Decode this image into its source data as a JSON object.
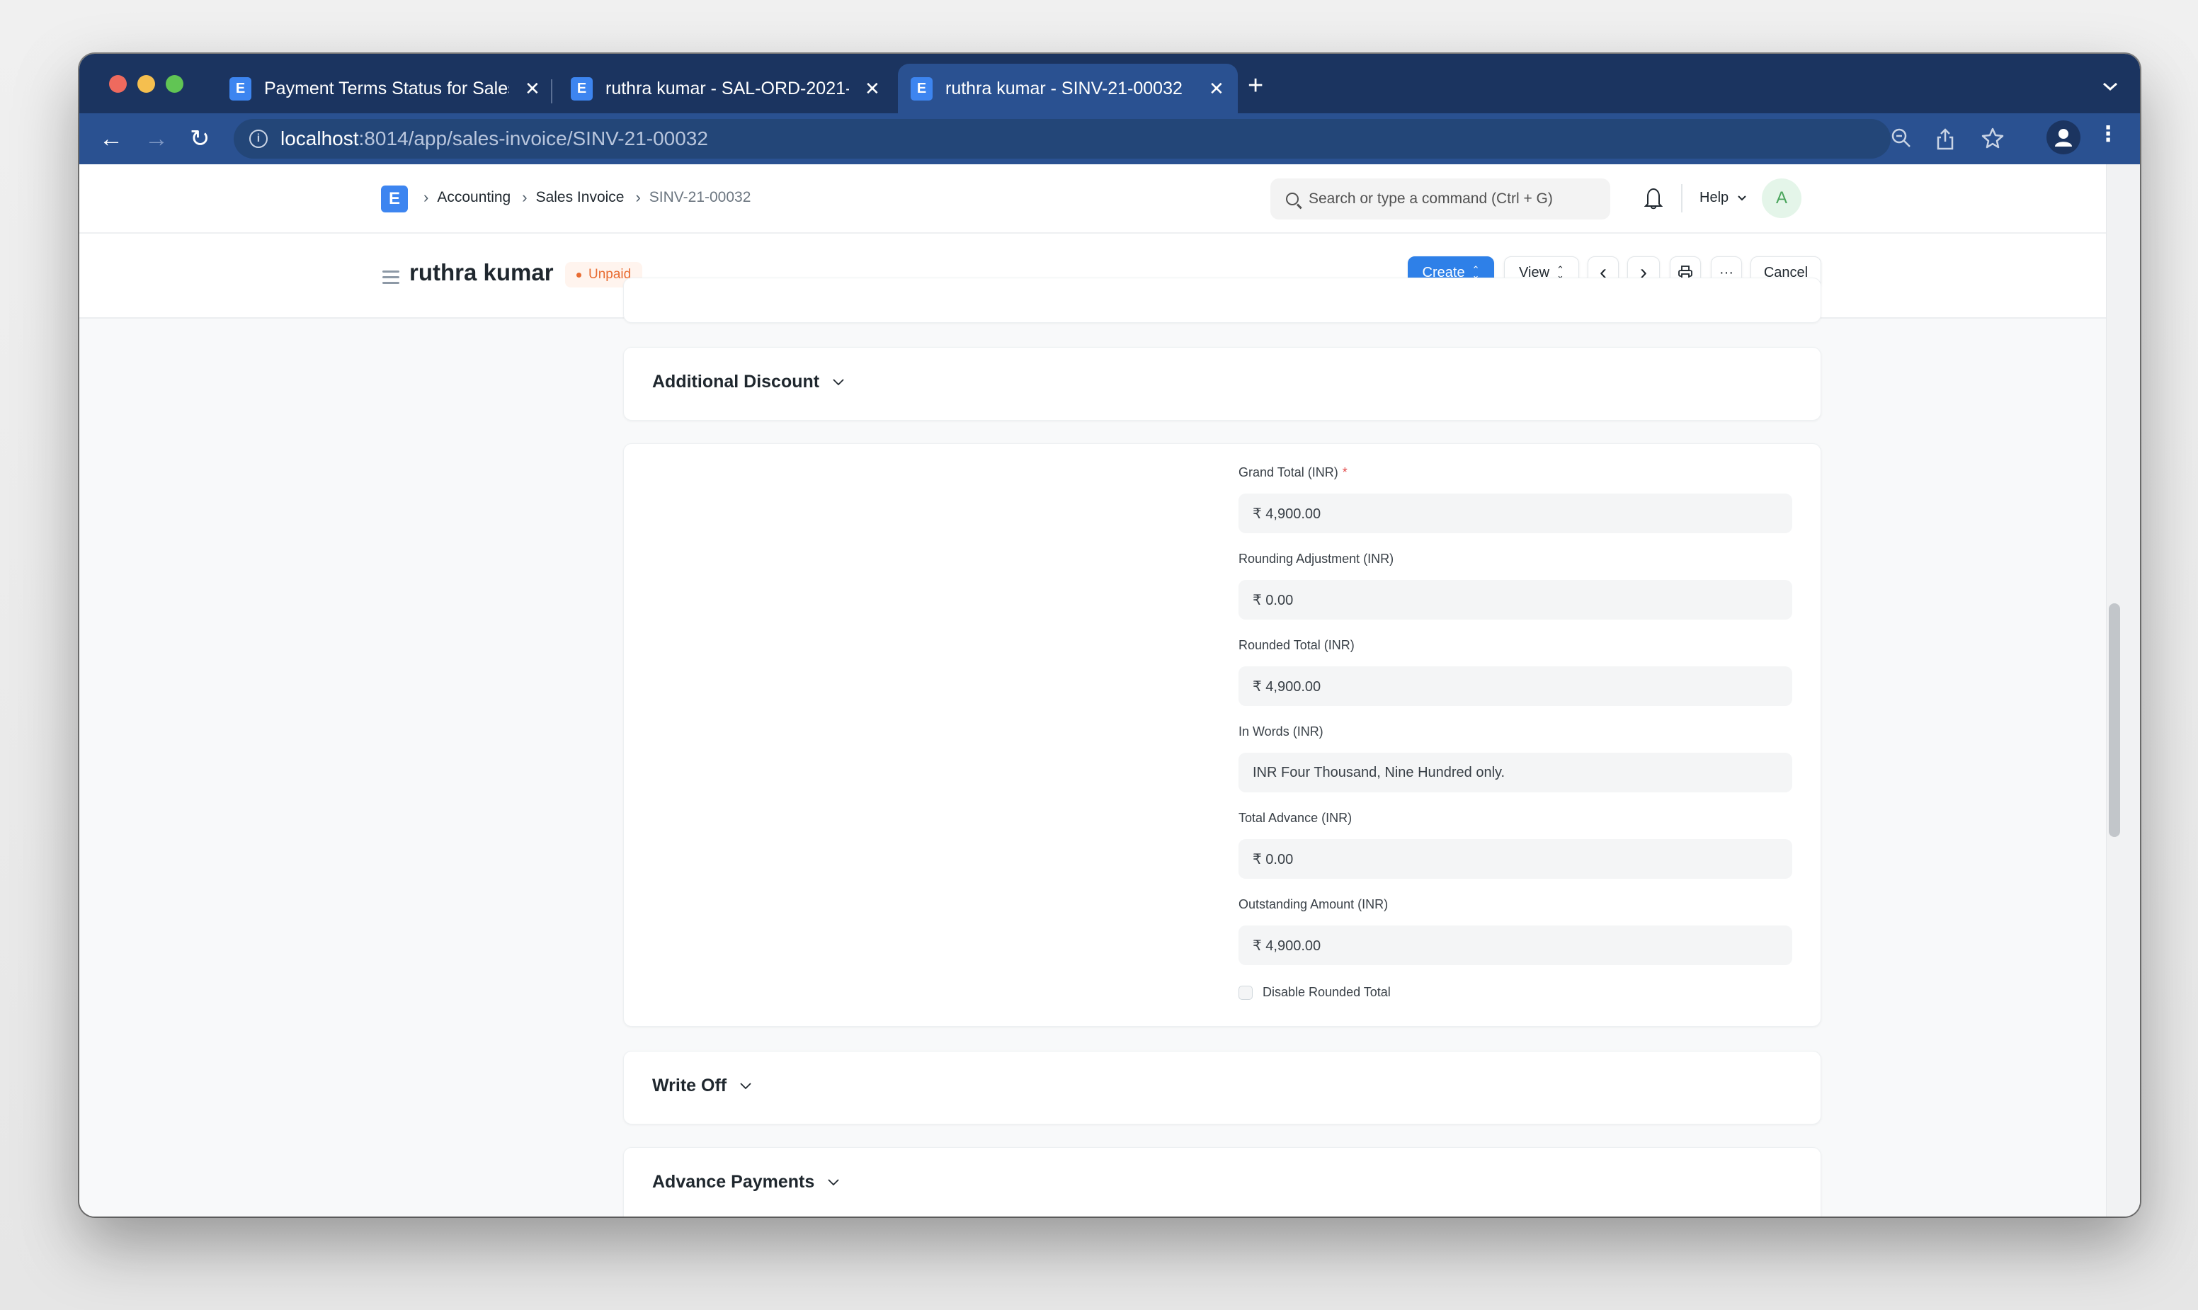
{
  "browser": {
    "tabs": [
      {
        "title": "Payment Terms Status for Sales",
        "active": false
      },
      {
        "title": "ruthra kumar - SAL-ORD-2021-",
        "active": false
      },
      {
        "title": "ruthra kumar - SINV-21-00032",
        "active": true
      }
    ],
    "favicon_letter": "E",
    "close_glyph": "✕",
    "new_tab_glyph": "+",
    "tab_menu_glyph": "⌄",
    "url_host": "localhost",
    "url_path": ":8014/app/sales-invoice/SINV-21-00032",
    "icons": {
      "back": "←",
      "forward": "→",
      "reload": "↻",
      "info": "i",
      "zoom_out": "⊖",
      "share": "⇪",
      "bookmark": "☆",
      "menu": "⋮"
    }
  },
  "navbar": {
    "logo_letter": "E",
    "breadcrumbs": [
      "Accounting",
      "Sales Invoice",
      "SINV-21-00032"
    ],
    "breadcrumb_separator": "›",
    "search_placeholder": "Search or type a command (Ctrl + G)",
    "help_label": "Help",
    "help_chevron": "⌄",
    "avatar_initial": "A"
  },
  "page_header": {
    "title": "ruthra kumar",
    "status": "Unpaid",
    "status_color": "#e86c32",
    "buttons": {
      "create": "Create",
      "view": "View",
      "prev": "‹",
      "next": "›",
      "print": "⎙",
      "more": "···",
      "cancel": "Cancel"
    },
    "accent_color": "#2e80e8"
  },
  "sections": {
    "additional_discount": {
      "title": "Additional Discount",
      "collapsed": true
    },
    "totals": {
      "fields": [
        {
          "label": "Grand Total (INR)",
          "required": true,
          "value": "₹ 4,900.00"
        },
        {
          "label": "Rounding Adjustment (INR)",
          "required": false,
          "value": "₹ 0.00"
        },
        {
          "label": "Rounded Total (INR)",
          "required": false,
          "value": "₹ 4,900.00"
        },
        {
          "label": "In Words (INR)",
          "required": false,
          "value": "INR Four Thousand, Nine Hundred only."
        },
        {
          "label": "Total Advance (INR)",
          "required": false,
          "value": "₹ 0.00"
        },
        {
          "label": "Outstanding Amount (INR)",
          "required": false,
          "value": "₹ 4,900.00"
        }
      ],
      "required_mark": "*",
      "checkbox": {
        "label": "Disable Rounded Total",
        "checked": false
      }
    },
    "write_off": {
      "title": "Write Off",
      "collapsed": true
    },
    "advance_payments": {
      "title": "Advance Payments",
      "collapsed": true
    }
  }
}
